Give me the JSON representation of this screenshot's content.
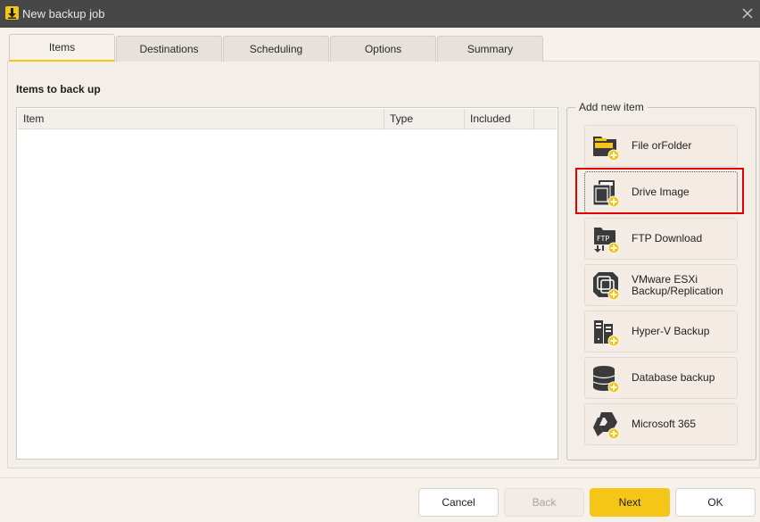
{
  "window": {
    "title": "New backup job"
  },
  "tabs": [
    {
      "label": "Items",
      "active": true
    },
    {
      "label": "Destinations",
      "active": false
    },
    {
      "label": "Scheduling",
      "active": false
    },
    {
      "label": "Options",
      "active": false
    },
    {
      "label": "Summary",
      "active": false
    }
  ],
  "items_section": {
    "title": "Items to back up",
    "columns": [
      "Item",
      "Type",
      "Included"
    ],
    "rows": []
  },
  "add_new_item": {
    "label": "Add new item",
    "buttons": [
      {
        "label": "File orFolder",
        "icon": "folder-add-icon"
      },
      {
        "label": "Drive Image",
        "icon": "drive-image-add-icon",
        "focused": true
      },
      {
        "label": "FTP Download",
        "icon": "ftp-add-icon"
      },
      {
        "label": "VMware ESXi Backup/Replication",
        "icon": "vmware-add-icon"
      },
      {
        "label": "Hyper-V Backup",
        "icon": "hyperv-add-icon"
      },
      {
        "label": "Database backup",
        "icon": "database-add-icon"
      },
      {
        "label": "Microsoft 365",
        "icon": "microsoft365-add-icon"
      }
    ]
  },
  "footer": {
    "cancel": "Cancel",
    "back": "Back",
    "next": "Next",
    "ok": "OK"
  },
  "colors": {
    "accent": "#f5c518",
    "titlebar": "#474747",
    "highlight": "#e30000"
  }
}
